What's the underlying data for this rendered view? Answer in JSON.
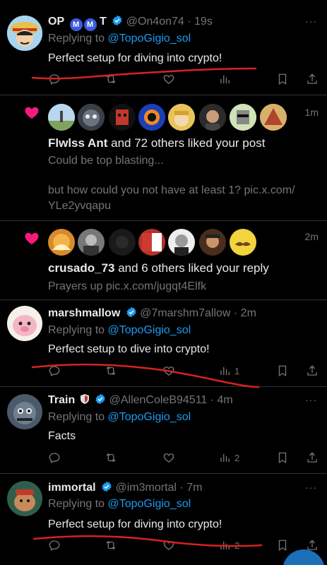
{
  "posts": [
    {
      "display_name": "OP",
      "badges": [
        "M",
        "M",
        "T"
      ],
      "handle": "@On4on74",
      "time": "· 19s",
      "replying_prefix": "Replying to ",
      "replying_handle": "@TopoGigio_sol",
      "text": "Perfect setup for diving into crypto!",
      "reply_count": "",
      "retweet_count": "",
      "like_count": "",
      "view_count": ""
    },
    {
      "display_name": "marshmallow",
      "handle": "@7marshm7allow",
      "time": "· 2m",
      "replying_prefix": "Replying to ",
      "replying_handle": "@TopoGigio_sol",
      "text": "Perfect setup to dive into crypto!",
      "view_count": "1"
    },
    {
      "display_name": "Train",
      "handle": "@AllenColeB94511",
      "time": "· 4m",
      "replying_prefix": "Replying to ",
      "replying_handle": "@TopoGigio_sol",
      "text": "Facts",
      "view_count": "2"
    },
    {
      "display_name": "immortal",
      "handle": "@im3mortal",
      "time": "· 7m",
      "replying_prefix": "Replying to ",
      "replying_handle": "@TopoGigio_sol",
      "text": "Perfect setup for diving into crypto!",
      "view_count": "2"
    }
  ],
  "notifications": [
    {
      "time": "1m",
      "actor": "Flwlss Ant",
      "action": " and 72 others liked your post",
      "quote_line1": "Could be top blasting...",
      "quote_line2": "but how could you not have at least 1? pic.x.com/",
      "quote_line3": "YLe2yvqapu"
    },
    {
      "time": "2m",
      "actor": "crusado_73",
      "action": " and 6 others liked your reply",
      "quote_line1": "Prayers up pic.x.com/jugqt4Elfk"
    }
  ],
  "more_label": "···",
  "colors": {
    "accent": "#1d9bf0",
    "like": "#f91880",
    "muted": "#71767b",
    "annotation": "#d8221f"
  },
  "icons": [
    "reply-icon",
    "retweet-icon",
    "like-icon",
    "views-icon",
    "bookmark-icon",
    "share-icon",
    "heart-notification-icon",
    "verified-icon",
    "more-icon"
  ]
}
